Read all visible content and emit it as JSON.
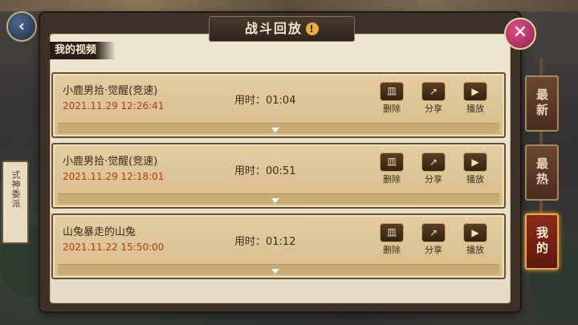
{
  "header": {
    "title": "战斗回放"
  },
  "sidebar_left": {
    "scroll_label": "式神委派"
  },
  "section": {
    "label": "我的视频"
  },
  "videos": [
    {
      "name": "小鹿男拾·觉醒(竞速)",
      "date": "2021.11.29 12:26:41",
      "duration": "用时：01:04"
    },
    {
      "name": "小鹿男拾·觉醒(竞速)",
      "date": "2021.11.29 12:18:01",
      "duration": "用时：00:51"
    },
    {
      "name": "山兔暴走的山兔",
      "date": "2021.11.22 15:50:00",
      "duration": "用时：01:12"
    }
  ],
  "actions": {
    "delete": "删除",
    "share": "分享",
    "play": "播放"
  },
  "tabs": [
    {
      "label": "最新",
      "active": false
    },
    {
      "label": "最热",
      "active": false
    },
    {
      "label": "我的",
      "active": true
    }
  ],
  "colors": {
    "accent": "#f0a946",
    "date_red": "#b2361e",
    "close_pink": "#e0508a"
  }
}
